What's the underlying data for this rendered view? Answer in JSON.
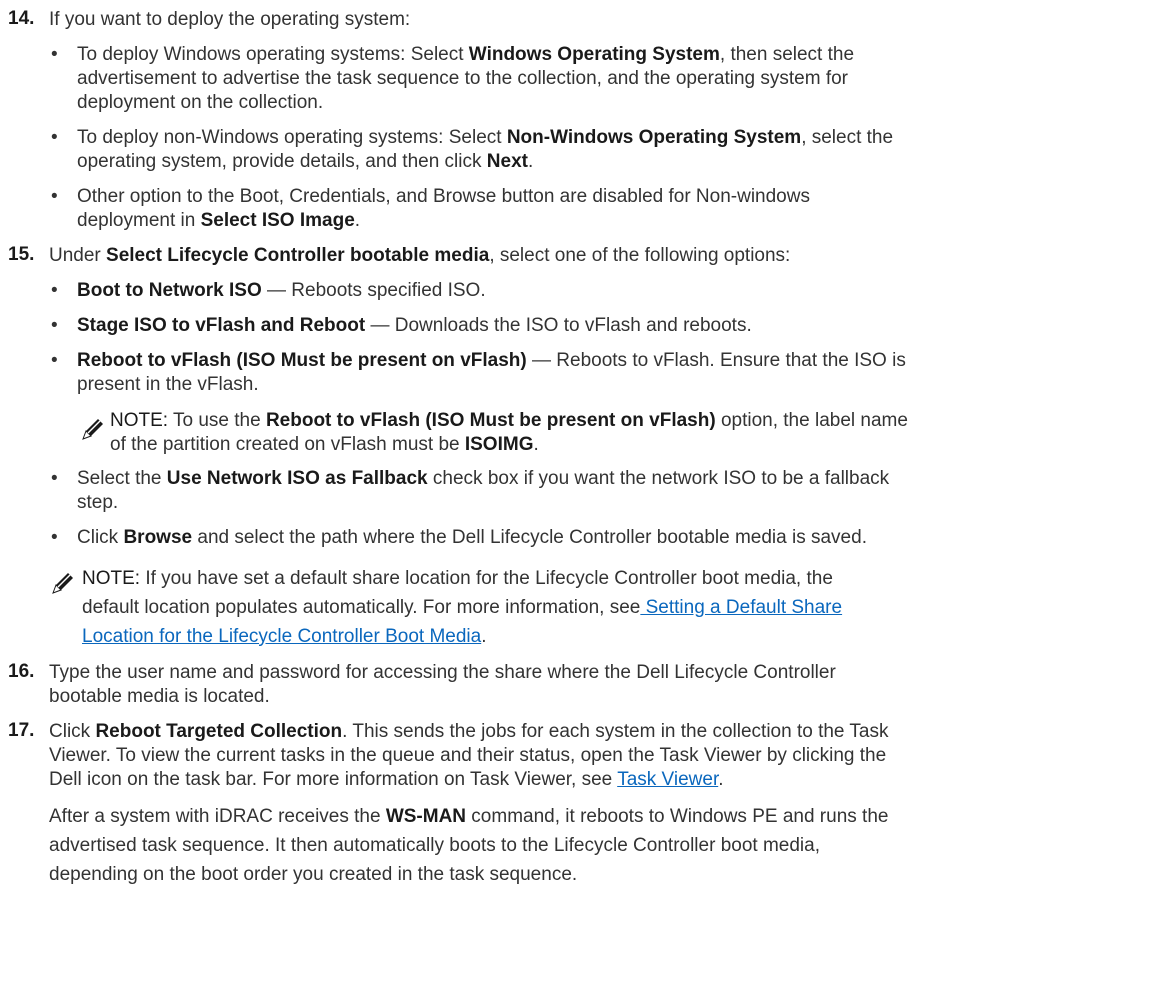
{
  "step14": {
    "num": "14.",
    "text": "If you want to deploy the operating system:",
    "b1": {
      "t1": "To deploy Windows operating systems: Select ",
      "b1": "Windows Operating System",
      "t2": ", then select the",
      "t3": "advertisement to advertise the task sequence to the collection, and the operating system for",
      "t4": "deployment on the collection."
    },
    "b2": {
      "t1": "To deploy non-Windows operating systems: Select ",
      "b1": "Non-Windows Operating System",
      "t2": ", select the",
      "t3": "operating system, provide details, and then click ",
      "b2": "Next",
      "t4": "."
    },
    "b3": {
      "t1": "Other option to the Boot, Credentials, and Browse button are disabled for Non-windows",
      "t2": "deployment in ",
      "b1": "Select ISO Image",
      "t3": "."
    }
  },
  "step15": {
    "num": "15.",
    "t1": "Under ",
    "b1": "Select Lifecycle Controller bootable media",
    "t2": ", select one of the following options:",
    "o1": {
      "b": "Boot to Network ISO",
      "t": " — Reboots specified ISO."
    },
    "o2": {
      "b": "Stage ISO to vFlash and Reboot",
      "t": " — Downloads the ISO to vFlash and reboots."
    },
    "o3": {
      "b": "Reboot to vFlash (ISO Must be present on vFlash)",
      "t": " — Reboots to vFlash. Ensure that the ISO is",
      "t2": "present in the vFlash."
    },
    "note1": {
      "label": "NOTE:",
      "t1": " To use the ",
      "b1": "Reboot to vFlash (ISO Must be present on vFlash)",
      "t2": " option, the label name",
      "t3": "of the partition created on vFlash must be ",
      "b2": "ISOIMG",
      "t4": "."
    },
    "o4": {
      "t1": "Select the ",
      "b": "Use Network ISO as Fallback",
      "t2": " check box if you want the network ISO to be a fallback",
      "t3": "step."
    },
    "o5": {
      "t1": "Click ",
      "b": "Browse",
      "t2": " and select the path where the Dell Lifecycle Controller bootable media is saved."
    },
    "note2": {
      "label": "NOTE:",
      "t1": " If you have set a default share location for the Lifecycle Controller boot media, the",
      "t2": "default location populates automatically. For more information, see",
      "link1": " Setting a Default Share",
      "link2": "Location for the Lifecycle Controller Boot Media",
      "t3": "."
    }
  },
  "step16": {
    "num": "16.",
    "t1": "Type the user name and password for accessing the share where the Dell Lifecycle Controller",
    "t2": "bootable media is located."
  },
  "step17": {
    "num": "17.",
    "t1": "Click ",
    "b1": "Reboot Targeted Collection",
    "t2": ". This sends the jobs for each system in the collection to the Task",
    "t3": "Viewer. To view the current tasks in the queue and their status, open the Task Viewer by clicking the",
    "t4": "Dell icon on the task bar. For more information on Task Viewer, see ",
    "link": "Task Viewer",
    "t5": ".",
    "p1": "After a system with iDRAC receives the ",
    "pb": "WS-MAN",
    "p2": " command, it reboots to Windows PE and runs the",
    "p3": "advertised task sequence. It then automatically boots to the Lifecycle Controller boot media,",
    "p4": "depending on the boot order you created in the task sequence."
  },
  "colors": {
    "text": "#333333",
    "link": "#0a67bd"
  },
  "icons": [
    "note-pencil-icon"
  ]
}
